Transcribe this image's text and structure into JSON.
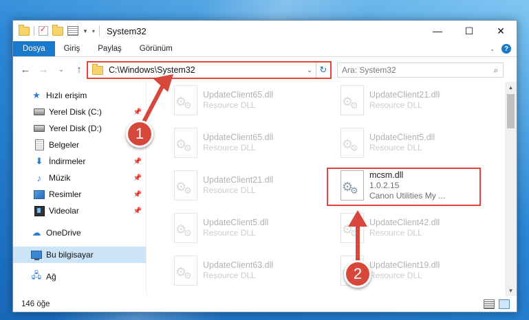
{
  "window": {
    "title": "System32",
    "controls": {
      "minimize": "—",
      "maximize": "☐",
      "close": "✕"
    }
  },
  "ribbon": {
    "tabs": [
      "Dosya",
      "Giriş",
      "Paylaş",
      "Görünüm"
    ]
  },
  "navigation": {
    "address": "C:\\Windows\\System32",
    "search_placeholder": "Ara: System32"
  },
  "sidebar": {
    "quick_access": "Hızlı erişim",
    "items": [
      {
        "label": "Yerel Disk (C:)",
        "icon": "disk-icon",
        "pinned": true
      },
      {
        "label": "Yerel Disk (D:)",
        "icon": "disk-icon",
        "pinned": false
      },
      {
        "label": "Belgeler",
        "icon": "documents-icon",
        "pinned": true
      },
      {
        "label": "İndirmeler",
        "icon": "downloads-icon",
        "pinned": true
      },
      {
        "label": "Müzik",
        "icon": "music-icon",
        "pinned": true
      },
      {
        "label": "Resimler",
        "icon": "pictures-icon",
        "pinned": true
      },
      {
        "label": "Videolar",
        "icon": "videos-icon",
        "pinned": true
      }
    ],
    "onedrive": "OneDrive",
    "this_pc": "Bu bilgisayar",
    "network": "Ağ"
  },
  "files": [
    {
      "name": "UpdateClient65.dll",
      "type": "Resource DLL",
      "faded": true
    },
    {
      "name": "UpdateClient21.dll",
      "type": "Resource DLL",
      "faded": true
    },
    {
      "name": "UpdateClient65.dll",
      "type": "Resource DLL",
      "faded": true
    },
    {
      "name": "UpdateClient5.dll",
      "type": "Resource DLL",
      "faded": true
    },
    {
      "name": "UpdateClient21.dll",
      "type": "Resource DLL",
      "faded": true
    },
    {
      "name": "mcsm.dll",
      "version": "1.0.2.15",
      "company": "Canon Utilities My ...",
      "faded": false
    },
    {
      "name": "UpdateClient5.dll",
      "type": "Resource DLL",
      "faded": true
    },
    {
      "name": "UpdateClient42.dll",
      "type": "Resource DLL",
      "faded": true
    },
    {
      "name": "UpdateClient63.dll",
      "type": "Resource DLL",
      "faded": true
    },
    {
      "name": "UpdateClient19.dll",
      "type": "Resource DLL",
      "faded": true
    }
  ],
  "status": {
    "item_count": "146 öğe"
  },
  "annotations": {
    "step1": "1",
    "step2": "2",
    "color": "#d8473c"
  }
}
